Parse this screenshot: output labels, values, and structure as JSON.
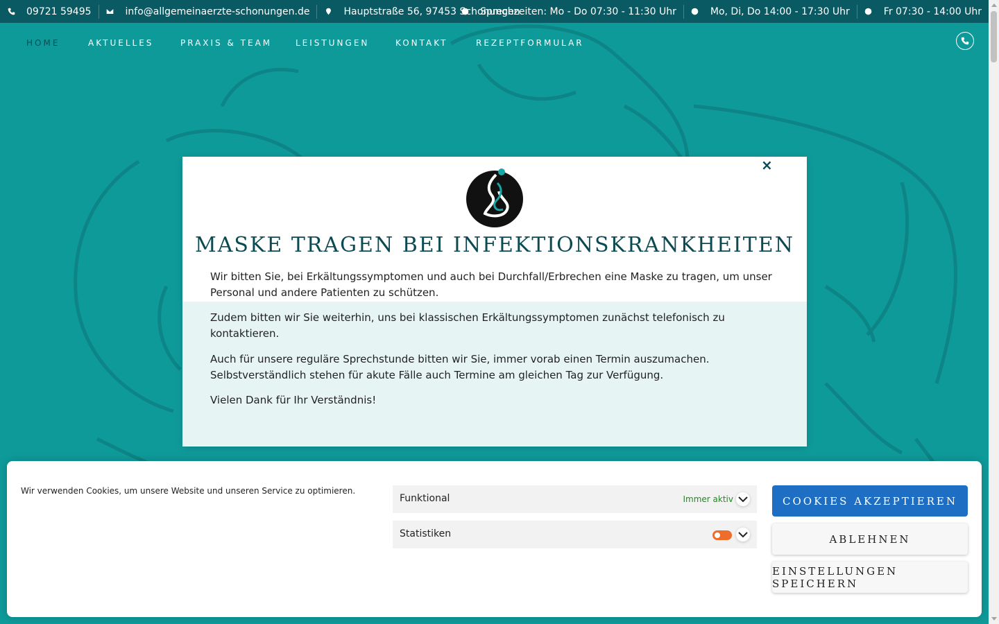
{
  "topbar": {
    "phone": "09721 59495",
    "email": "info@allgemeinaerzte-schonungen.de",
    "address": "Hauptstraße 56, 97453 Schonungen",
    "hours_1": "Sprechzeiten: Mo - Do 07:30 - 11:30 Uhr",
    "hours_2": "Mo, Di, Do 14:00 - 17:30 Uhr",
    "hours_3": "Fr 07:30 - 14:00 Uhr"
  },
  "nav": {
    "items": [
      "Home",
      "Aktuelles",
      "Praxis & Team",
      "Leistungen",
      "Kontakt",
      "Rezeptformular"
    ],
    "active": "Home"
  },
  "modal": {
    "close": "×",
    "title": "Maske tragen bei Infektionskrankheiten",
    "p1": "Wir bitten Sie, bei Erkältungssymptomen und auch bei Durchfall/Erbrechen eine Maske zu tragen, um unser Personal und andere Patienten zu schützen.",
    "p2": "Zudem bitten wir Sie weiterhin, uns bei klassischen Erkältungssymptomen zunächst telefonisch zu kontaktieren.",
    "p3": "Auch für unsere reguläre Sprechstunde bitten wir Sie, immer vorab einen Termin auszumachen. Selbstverständlich stehen für akute Fälle auch Termine am gleichen Tag zur Verfügung.",
    "p4": "Vielen Dank für Ihr Verständnis!"
  },
  "cookie": {
    "text": "Wir verwenden Cookies, um unsere Website und unseren Service zu optimieren.",
    "categories": [
      {
        "name": "Funktional",
        "status": "Immer aktiv"
      },
      {
        "name": "Statistiken",
        "status": ""
      }
    ],
    "accept": "Cookies akzeptieren",
    "decline": "Ablehnen",
    "save": "Einstellungen speichern"
  },
  "colors": {
    "teal": "#0f9a9a",
    "dark_teal": "#0a5a63",
    "accept_blue": "#1e6fc4",
    "toggle_orange": "#ef6c2a"
  }
}
